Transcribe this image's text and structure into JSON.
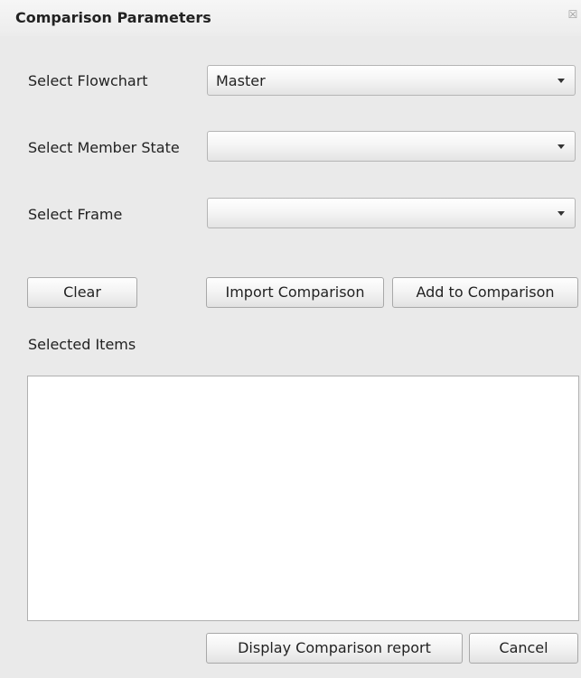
{
  "dialog": {
    "title": "Comparison Parameters",
    "close_icon": "close-icon"
  },
  "form": {
    "flowchart": {
      "label": "Select Flowchart",
      "value": "Master"
    },
    "member_state": {
      "label": "Select Member State",
      "value": ""
    },
    "frame": {
      "label": "Select Frame",
      "value": ""
    }
  },
  "buttons": {
    "clear": "Clear",
    "import": "Import Comparison",
    "add": "Add to Comparison",
    "display": "Display Comparison report",
    "cancel": "Cancel"
  },
  "selected_items": {
    "label": "Selected Items",
    "items": []
  }
}
